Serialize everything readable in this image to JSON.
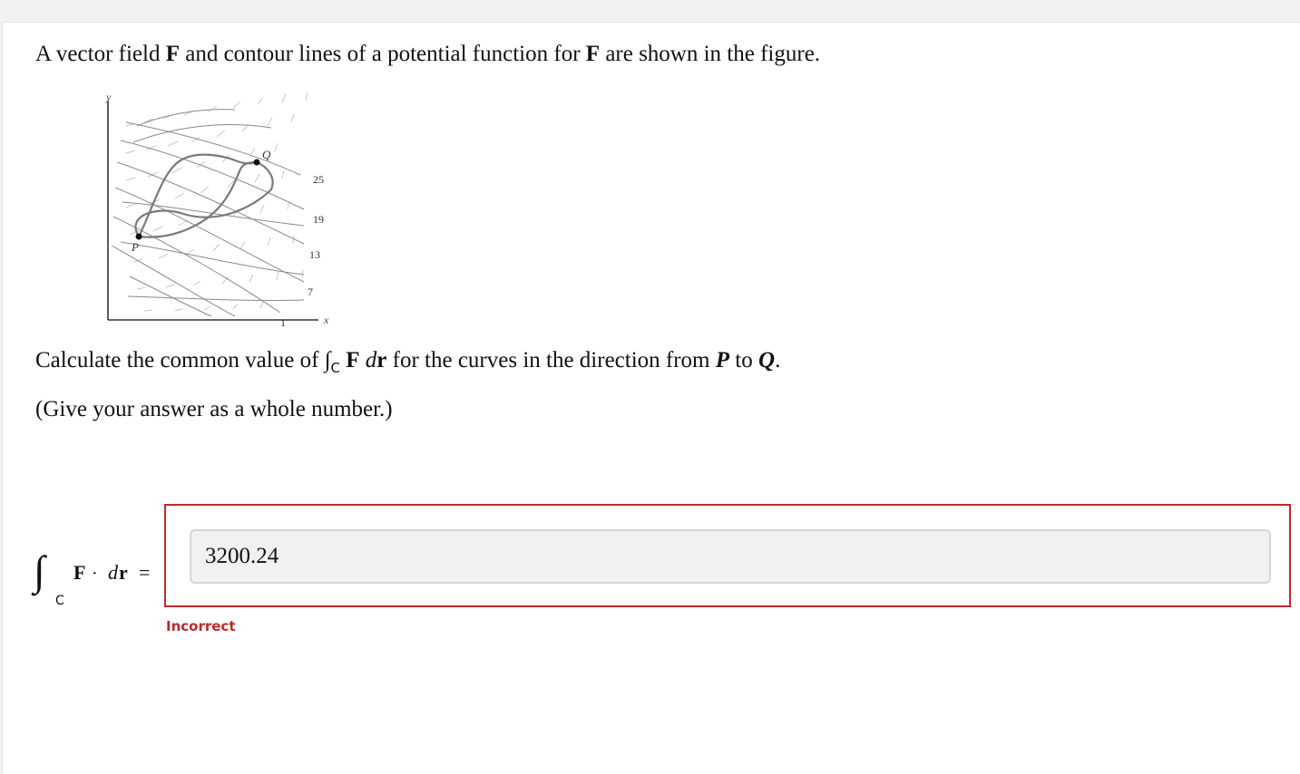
{
  "problem": {
    "intro": {
      "t1": "A vector field ",
      "F": "F",
      "t2": " and contour lines of a potential function for ",
      "F2": "F",
      "t3": " are shown in the figure."
    },
    "question": {
      "t1": "Calculate the common value of ",
      "integral": "∫",
      "sub": "C",
      "F": "F",
      "d": "d",
      "r": "r",
      "t2": " for the curves in the direction from ",
      "P": "P",
      "t3": " to ",
      "Q": "Q",
      "t4": "."
    },
    "hint": "(Give your answer as a whole number.)"
  },
  "figure": {
    "y_axis_label": "y",
    "x_axis_label": "x",
    "point_p_label": "P",
    "point_q_label": "Q",
    "contour_labels": [
      "25",
      "19",
      "13",
      "7",
      "1"
    ]
  },
  "answer_label": {
    "integral": "∫",
    "sub": "C",
    "F": "F",
    "dot": "·",
    "d": "d",
    "r": "r",
    "eq": "="
  },
  "answer": {
    "value": "3200.24",
    "feedback": "Incorrect"
  },
  "colors": {
    "error": "#c0282a",
    "input_bg": "#f1f1f1"
  }
}
